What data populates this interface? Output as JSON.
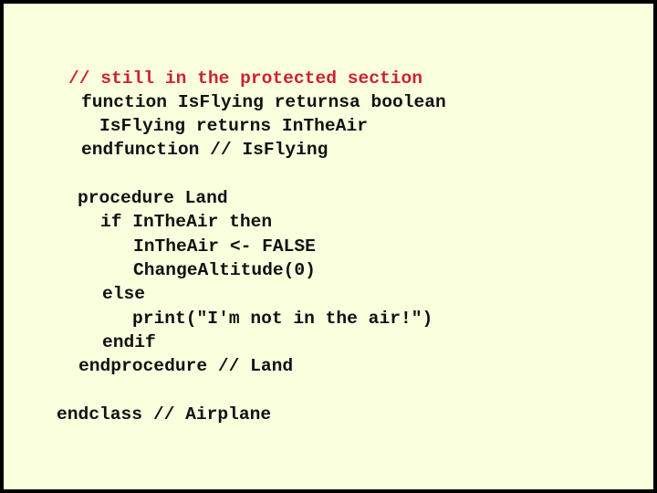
{
  "slide": {
    "colors": {
      "background": "#FAFFDE",
      "border": "#000000",
      "code_text": "#111111",
      "comment_text": "#CC2233"
    },
    "code_lines": [
      {
        "text": "// still in the protected section",
        "kind": "comment"
      },
      {
        "text": "function IsFlying returnsa boolean",
        "kind": "code"
      },
      {
        "text": "IsFlying returns InTheAir",
        "kind": "code"
      },
      {
        "text": "endfunction // IsFlying",
        "kind": "code"
      },
      {
        "text": "procedure Land",
        "kind": "code"
      },
      {
        "text": "if InTheAir then",
        "kind": "code"
      },
      {
        "text": "InTheAir <- FALSE",
        "kind": "code"
      },
      {
        "text": "ChangeAltitude(0)",
        "kind": "code"
      },
      {
        "text": "else",
        "kind": "code"
      },
      {
        "text": "print(\"I'm not in the air!\")",
        "kind": "code"
      },
      {
        "text": "endif",
        "kind": "code"
      },
      {
        "text": "endprocedure // Land",
        "kind": "code"
      },
      {
        "text": "endclass // Airplane",
        "kind": "code"
      }
    ]
  }
}
